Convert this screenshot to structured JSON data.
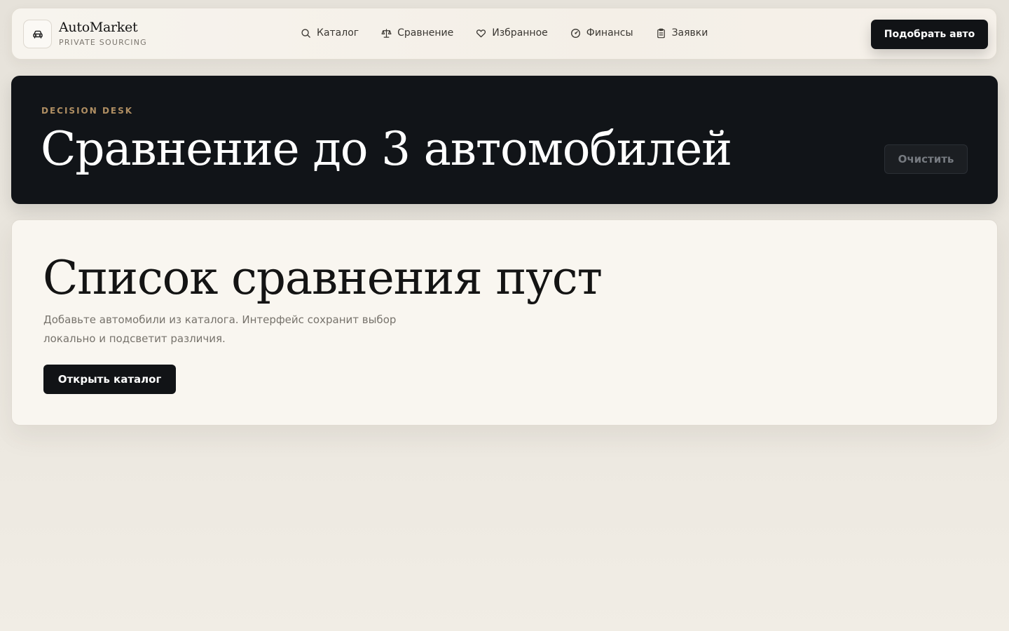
{
  "brand": {
    "title": "AutoMarket",
    "subtitle": "PRIVATE SOURCING",
    "logo_icon": "car-icon"
  },
  "nav": {
    "items": [
      {
        "label": "Каталог",
        "icon": "search-icon"
      },
      {
        "label": "Сравнение",
        "icon": "scale-icon"
      },
      {
        "label": "Избранное",
        "icon": "heart-icon"
      },
      {
        "label": "Финансы",
        "icon": "gauge-icon"
      },
      {
        "label": "Заявки",
        "icon": "clipboard-icon"
      }
    ],
    "cta_label": "Подобрать авто"
  },
  "hero": {
    "eyebrow": "DECISION DESK",
    "title": "Сравнение до 3 автомобилей",
    "clear_label": "Очистить"
  },
  "empty_state": {
    "title": "Список сравнения пуст",
    "description": "Добавьте автомобили из каталога. Интерфейс сохранит выбор локально и подсветит различия.",
    "button_label": "Открыть каталог"
  },
  "colors": {
    "accent": "#b08f63",
    "dark": "#111418",
    "surface": "#f9f6f0"
  }
}
